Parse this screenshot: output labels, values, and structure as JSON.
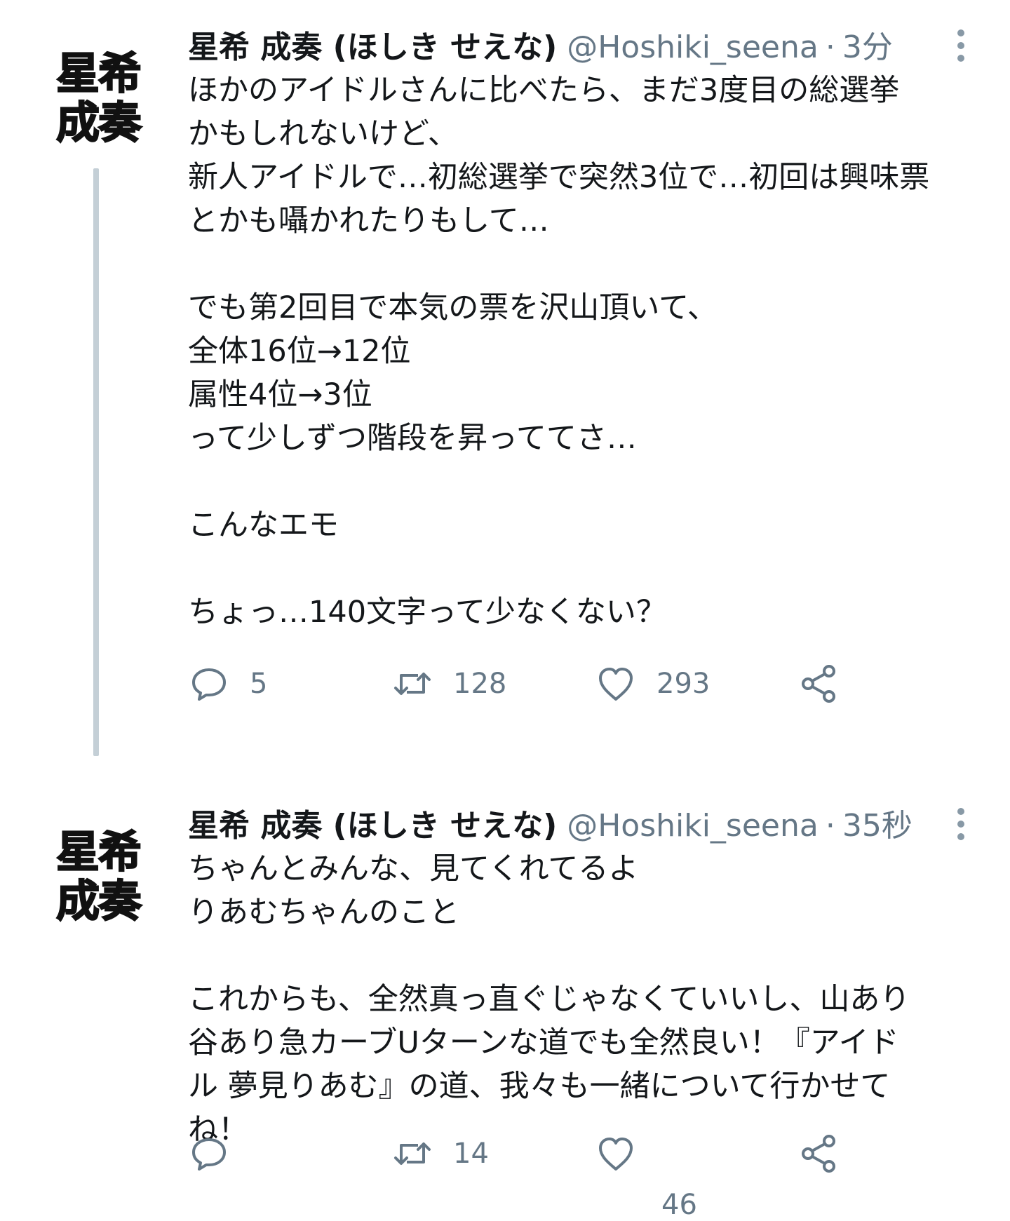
{
  "tweets": [
    {
      "avatar_text": [
        "星希",
        "成奏"
      ],
      "display_name": "星希 成奏 (ほしき せえな)",
      "handle": "@Hoshiki_seena",
      "separator": "·",
      "time": "3分",
      "lines": [
        "ほかのアイドルさんに比べたら、まだ3度目の総選挙",
        "かもしれないけど、",
        "新人アイドルで…初総選挙で突然3位で…初回は興味票",
        "とかも囁かれたりもして…",
        "",
        "でも第2回目で本気の票を沢山頂いて、",
        "全体16位→12位",
        "属性4位→3位",
        "って少しずつ階段を昇っててさ…",
        "",
        "こんなエモ",
        "",
        "ちょっ…140文字って少なくない？"
      ],
      "reply_count": "5",
      "retweet_count": "128",
      "like_count": "293"
    },
    {
      "avatar_text": [
        "星希",
        "成奏"
      ],
      "display_name": "星希 成奏 (ほしき せえな)",
      "handle": "@Hoshiki_seena",
      "separator": "·",
      "time": "35秒",
      "lines": [
        "ちゃんとみんな、見てくれてるよ",
        "りあむちゃんのこと",
        "",
        "これからも、全然真っ直ぐじゃなくていいし、山あり",
        "谷あり急カーブUターンな道でも全然良い！『アイド",
        "ル 夢見りあむ』の道、我々も一緒について行かせて",
        "ね！"
      ],
      "reply_count": "",
      "retweet_count": "14",
      "like_count": "46"
    }
  ],
  "icons": {
    "reply": "speech-bubble-icon",
    "retweet": "retweet-arrows-icon",
    "like": "heart-outline-icon",
    "share": "share-nodes-icon",
    "more": "vertical-ellipsis-icon"
  },
  "colors": {
    "text": "#14171a",
    "secondary": "#657786",
    "icon": "#657786",
    "thread_line": "#c4cfd6",
    "background": "#ffffff"
  }
}
